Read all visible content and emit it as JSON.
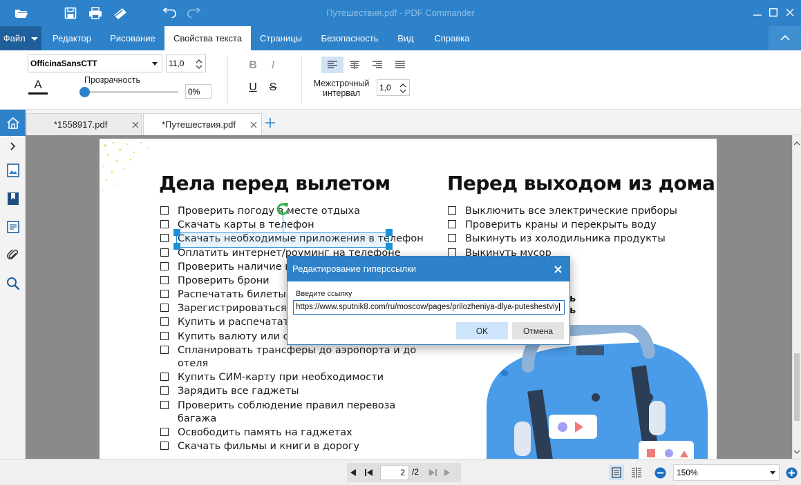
{
  "window": {
    "title": "Путешествия.pdf - PDF Commander"
  },
  "menu": {
    "file": "Файл",
    "tabs": [
      "Редактор",
      "Рисование",
      "Свойства текста",
      "Страницы",
      "Безопасность",
      "Вид",
      "Справка"
    ],
    "active_tab": "Свойства текста"
  },
  "ribbon": {
    "font_name": "OfficinaSansCTT",
    "font_size": "11,0",
    "text_color_glyph": "A",
    "transparency_label": "Прозрачность",
    "transparency_value": "0%",
    "transparency_level": 0,
    "bold": "B",
    "italic": "I",
    "underline": "U",
    "strike": "S",
    "line_spacing_label_1": "Межстрочный",
    "line_spacing_label_2": "интервал",
    "line_spacing_value": "1,0",
    "active_alignment": "left"
  },
  "tabs": [
    {
      "label": "*1558917.pdf",
      "active": false
    },
    {
      "label": "*Путешествия.pdf",
      "active": true
    }
  ],
  "document": {
    "left_heading": "Дела перед вылетом",
    "left_items": [
      "Проверить погоду в месте отдыха",
      "Скачать карты в телефон",
      "Скачать необходимые приложения в телефон",
      "Оплатить интернет/роуминг на телефоне",
      "Проверить наличие и пр",
      "Проверить брони",
      "Распечатать билеты",
      "Зарегистрироваться на",
      "Купить и распечатать ст",
      "Купить валюту или снят",
      "Спланировать трансферы до аэропорта и до",
      "отеля",
      "Купить СИМ-карту при необходимости",
      "Зарядить все гаджеты",
      "Проверить соблюдение правил перевоза",
      "багажа",
      "Освободить память на гаджетах",
      "Скачать фильмы и книги в дорогу"
    ],
    "right_heading": "Перед выходом из дома",
    "right_items": [
      "Выключить все электрические приборы",
      "Проверить краны и перекрыть воду",
      "Выкинуть из холодильника продукты",
      "Выкинуть мусор"
    ],
    "right_fragment_1": "ь",
    "right_fragment_2": "ь"
  },
  "dialog": {
    "title": "Редактирование гиперссылки",
    "label": "Введите ссылку",
    "url": "https://www.sputnik8.com/ru/moscow/pages/prilozheniya-dlya-puteshestviy",
    "ok": "OK",
    "cancel": "Отмена"
  },
  "status": {
    "page_current": "2",
    "page_total": "/2",
    "zoom": "150%"
  },
  "colors": {
    "accent": "#2e82c9",
    "file_tab": "#1f5f9c",
    "selection": "#cfe2f6",
    "ok_button": "#cde5fa"
  }
}
